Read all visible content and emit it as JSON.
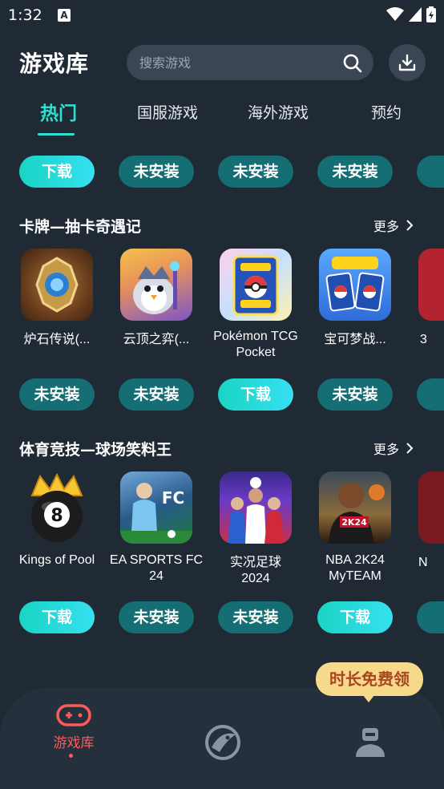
{
  "status_bar": {
    "time": "1:32",
    "a_glyph": "A"
  },
  "header": {
    "title": "游戏库",
    "search_placeholder": "搜索游戏"
  },
  "tabs": [
    {
      "label": "热门",
      "active": true
    },
    {
      "label": "国服游戏",
      "active": false
    },
    {
      "label": "海外游戏",
      "active": false
    },
    {
      "label": "预约",
      "active": false
    }
  ],
  "top_buttons": [
    "下载",
    "未安装",
    "未安装",
    "未安装"
  ],
  "sections": [
    {
      "title": "卡牌—抽卡奇遇记",
      "more": "更多",
      "games": [
        {
          "name": "炉石传说(...",
          "button": "未安装"
        },
        {
          "name": "云顶之弈(...",
          "button": "未安装"
        },
        {
          "name": "Pokémon TCG Pocket",
          "button": "下载"
        },
        {
          "name": "宝可梦战...",
          "button": "未安装"
        }
      ],
      "partial_name": "3"
    },
    {
      "title": "体育竞技—球场笑料王",
      "more": "更多",
      "games": [
        {
          "name": "Kings of Pool",
          "button": "下载"
        },
        {
          "name": "EA SPORTS FC 24",
          "button": "未安装"
        },
        {
          "name": "实况足球 2024",
          "button": "未安装"
        },
        {
          "name": "NBA 2K24 MyTEAM",
          "button": "下载"
        }
      ],
      "partial_name": "N"
    }
  ],
  "promo": {
    "text": "时长免费领"
  },
  "bottom_nav": [
    {
      "label": "游戏库",
      "icon": "gamepad-icon",
      "active": true
    },
    {
      "label": "",
      "icon": "accelerator-icon",
      "active": false
    },
    {
      "label": "",
      "icon": "profile-icon",
      "active": false
    }
  ],
  "colors": {
    "background": "#1f2a35",
    "accent": "#2fe0d0",
    "download_button": "#19d4c4",
    "uninstalled_button": "#156e73",
    "active_nav": "#ff5a5a",
    "promo_bg": "#f6d98a"
  }
}
